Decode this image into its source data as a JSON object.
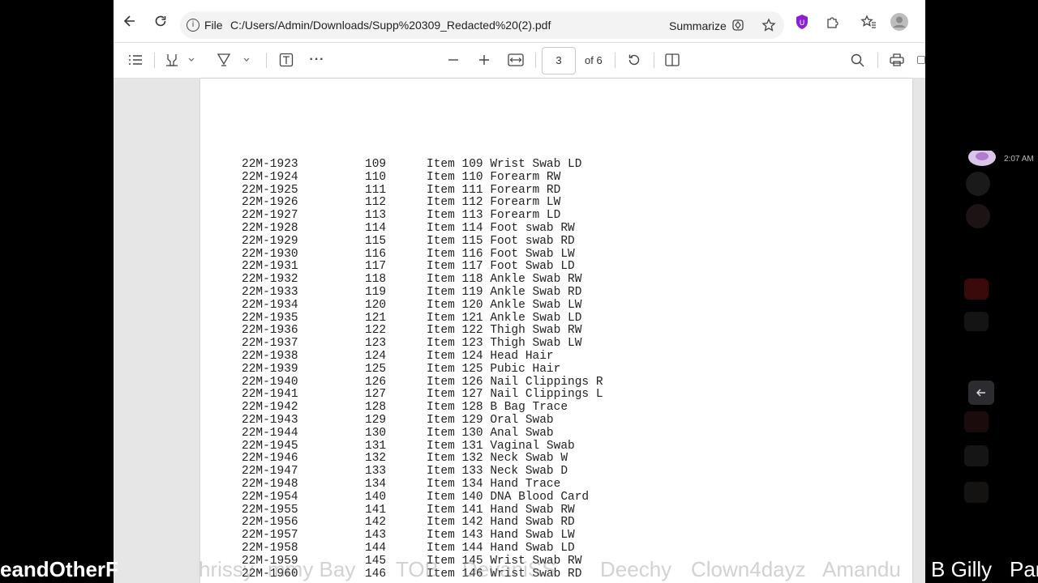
{
  "browser": {
    "protocol": "File",
    "url": "C:/Users/Admin/Downloads/Supp%20309_Redacted%20(2).pdf",
    "summarize_label": "Summarize"
  },
  "pdf_toolbar": {
    "current_page": "3",
    "page_count_label": "of 6"
  },
  "document": {
    "rows": [
      [
        "22M-1923",
        "109",
        "Item 109 Wrist Swab LD"
      ],
      [
        "22M-1924",
        "110",
        "Item 110 Forearm RW"
      ],
      [
        "22M-1925",
        "111",
        "Item 111 Forearm RD"
      ],
      [
        "22M-1926",
        "112",
        "Item 112 Forearm LW"
      ],
      [
        "22M-1927",
        "113",
        "Item 113 Forearm LD"
      ],
      [
        "22M-1928",
        "114",
        "Item 114 Foot swab RW"
      ],
      [
        "22M-1929",
        "115",
        "Item 115 Foot swab RD"
      ],
      [
        "22M-1930",
        "116",
        "Item 116 Foot Swab LW"
      ],
      [
        "22M-1931",
        "117",
        "Item 117 Foot Swab LD"
      ],
      [
        "22M-1932",
        "118",
        "Item 118 Ankle Swab RW"
      ],
      [
        "22M-1933",
        "119",
        "Item 119 Ankle Swab RD"
      ],
      [
        "22M-1934",
        "120",
        "Item 120 Ankle Swab LW"
      ],
      [
        "22M-1935",
        "121",
        "Item 121 Ankle Swab LD"
      ],
      [
        "22M-1936",
        "122",
        "Item 122 Thigh Swab RW"
      ],
      [
        "22M-1937",
        "123",
        "Item 123 Thigh Swab LW"
      ],
      [
        "22M-1938",
        "124",
        "Item 124 Head Hair"
      ],
      [
        "22M-1939",
        "125",
        "Item 125 Pubic Hair"
      ],
      [
        "22M-1940",
        "126",
        "Item 126 Nail Clippings R"
      ],
      [
        "22M-1941",
        "127",
        "Item 127 Nail Clippings L"
      ],
      [
        "22M-1942",
        "128",
        "Item 128 B Bag Trace"
      ],
      [
        "22M-1943",
        "129",
        "Item 129 Oral Swab"
      ],
      [
        "22M-1944",
        "130",
        "Item 130 Anal Swab"
      ],
      [
        "22M-1945",
        "131",
        "Item 131 Vaginal Swab"
      ],
      [
        "22M-1946",
        "132",
        "Item 132 Neck Swab W"
      ],
      [
        "22M-1947",
        "133",
        "Item 133 Neck Swab D"
      ],
      [
        "22M-1948",
        "134",
        "Item 134 Hand Trace"
      ],
      [
        "22M-1954",
        "140",
        "Item 140 DNA Blood Card"
      ],
      [
        "22M-1955",
        "141",
        "Item 141 Hand Swab RW"
      ],
      [
        "22M-1956",
        "142",
        "Item 142 Hand Swab RD"
      ],
      [
        "22M-1957",
        "143",
        "Item 143 Hand Swab LW"
      ],
      [
        "22M-1958",
        "144",
        "Item 144 Hand Swab LD"
      ],
      [
        "22M-1959",
        "145",
        "Item 145 Wrist Swab RW"
      ],
      [
        "22M-1960",
        "146",
        "Item 146 Wrist Swab RD"
      ]
    ]
  },
  "side_panel": {
    "timestamp": "2:07 AM"
  },
  "overlay": {
    "names": [
      "eandOtherF",
      "hrissy",
      "mmy Bay",
      "TOB",
      "DevaniSS",
      "Deechy",
      "Clown4dayz",
      "Amandu",
      "B Gilly",
      "Pan"
    ]
  },
  "colors": {
    "shield_accent": "#8a1fd6",
    "overlay_text_dim": "#7d7d8c",
    "overlay_text_bright": "#ffffff"
  }
}
